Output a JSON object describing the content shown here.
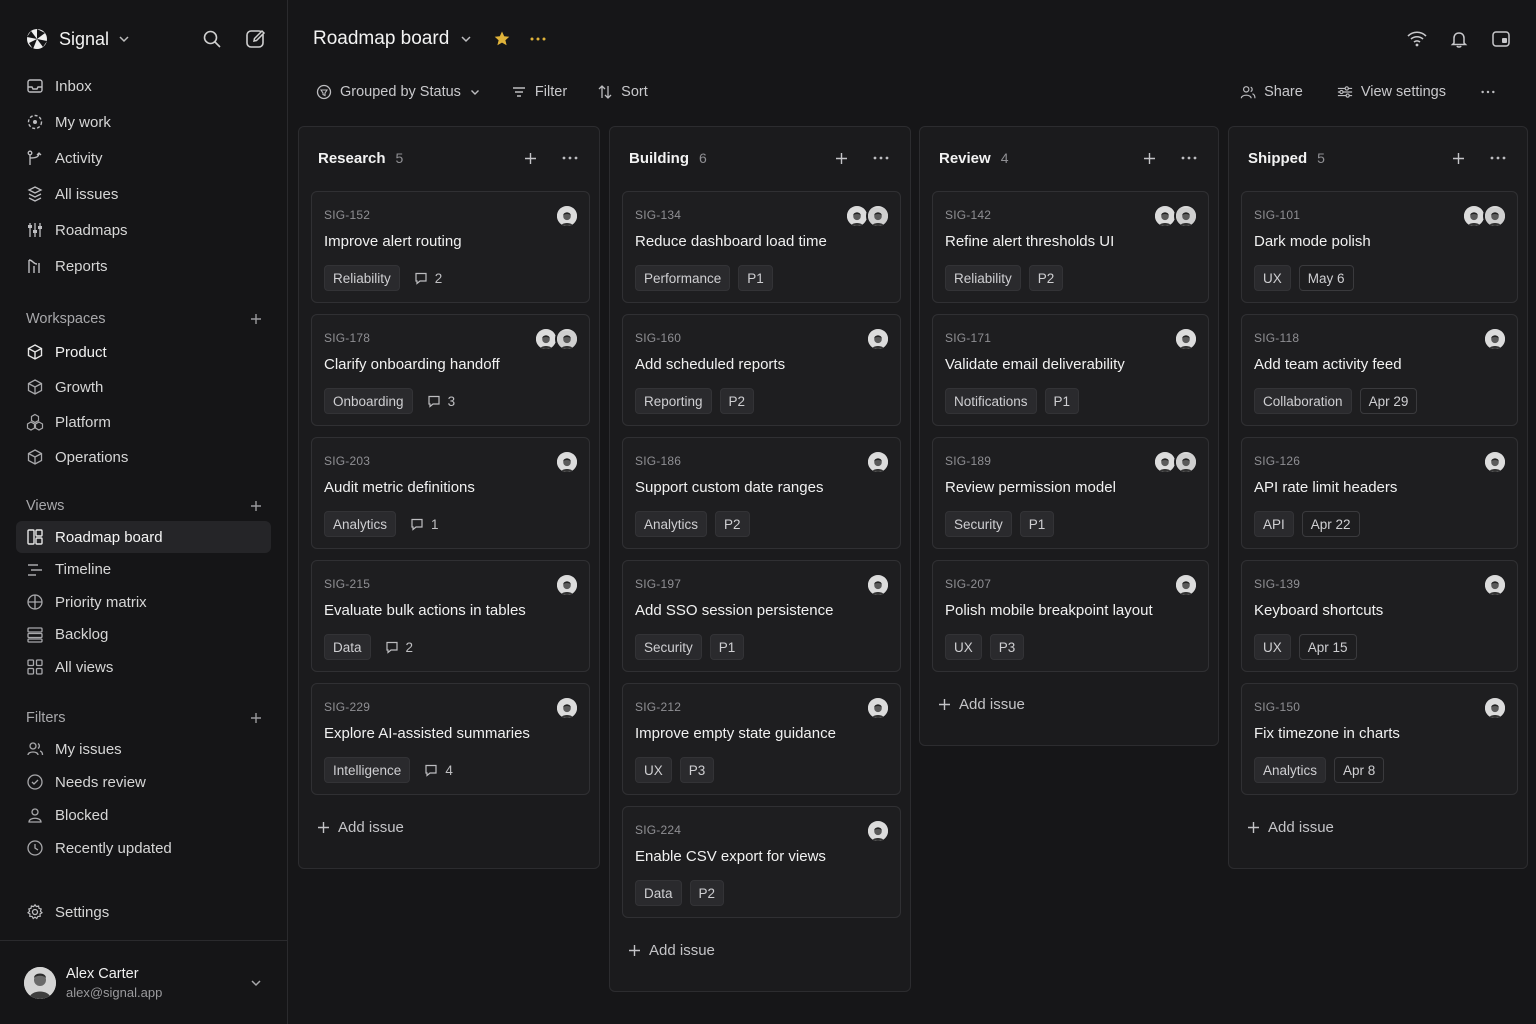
{
  "app": {
    "name": "Signal"
  },
  "sidebar": {
    "nav": [
      {
        "label": "Inbox",
        "icon": "inbox-icon"
      },
      {
        "label": "My work",
        "icon": "target-icon"
      },
      {
        "label": "Activity",
        "icon": "activity-icon"
      },
      {
        "label": "All issues",
        "icon": "issues-icon"
      },
      {
        "label": "Roadmaps",
        "icon": "roadmap-icon"
      },
      {
        "label": "Reports",
        "icon": "reports-icon"
      }
    ],
    "workspaces_title": "Workspaces",
    "workspaces": [
      {
        "label": "Product"
      },
      {
        "label": "Growth"
      },
      {
        "label": "Platform"
      },
      {
        "label": "Operations"
      }
    ],
    "views_title": "Views",
    "views": [
      {
        "label": "Roadmap board",
        "icon": "board-icon"
      },
      {
        "label": "Timeline",
        "icon": "timeline-icon"
      },
      {
        "label": "Priority matrix",
        "icon": "matrix-icon"
      },
      {
        "label": "Backlog",
        "icon": "backlog-icon"
      },
      {
        "label": "All views",
        "icon": "grid-icon"
      }
    ],
    "filters_title": "Filters",
    "filters": [
      {
        "label": "My issues",
        "icon": "users-icon"
      },
      {
        "label": "Needs review",
        "icon": "review-icon"
      },
      {
        "label": "Blocked",
        "icon": "blocked-icon"
      },
      {
        "label": "Recently updated",
        "icon": "clock-icon"
      }
    ],
    "settings_label": "Settings",
    "user": {
      "name": "Alex Carter",
      "email": "alex@signal.app"
    }
  },
  "header": {
    "title": "Roadmap board",
    "star_color": "#e0b33a"
  },
  "toolbar": {
    "group_label": "Grouped by Status",
    "filter_label": "Filter",
    "sort_label": "Sort",
    "share_label": "Share",
    "view_settings_label": "View settings"
  },
  "add_issue_label": "Add issue",
  "columns": [
    {
      "name": "Research",
      "count": "5",
      "cards": [
        {
          "id": "SIG-152",
          "title": "Improve alert routing",
          "tags": [
            "Reliability"
          ],
          "comments": "2",
          "avatars": 1
        },
        {
          "id": "SIG-178",
          "title": "Clarify onboarding handoff",
          "tags": [
            "Onboarding"
          ],
          "comments": "3",
          "avatars": 2
        },
        {
          "id": "SIG-203",
          "title": "Audit metric definitions",
          "tags": [
            "Analytics"
          ],
          "comments": "1",
          "avatars": 1
        },
        {
          "id": "SIG-215",
          "title": "Evaluate bulk actions in tables",
          "tags": [
            "Data"
          ],
          "comments": "2",
          "avatars": 1
        },
        {
          "id": "SIG-229",
          "title": "Explore AI-assisted summaries",
          "tags": [
            "Intelligence"
          ],
          "comments": "4",
          "avatars": 1
        }
      ]
    },
    {
      "name": "Building",
      "count": "6",
      "cards": [
        {
          "id": "SIG-134",
          "title": "Reduce dashboard load time",
          "tags": [
            "Performance",
            "P1"
          ],
          "avatars": 2
        },
        {
          "id": "SIG-160",
          "title": "Add scheduled reports",
          "tags": [
            "Reporting",
            "P2"
          ],
          "avatars": 1
        },
        {
          "id": "SIG-186",
          "title": "Support custom date ranges",
          "tags": [
            "Analytics",
            "P2"
          ],
          "avatars": 1
        },
        {
          "id": "SIG-197",
          "title": "Add SSO session persistence",
          "tags": [
            "Security",
            "P1"
          ],
          "avatars": 1
        },
        {
          "id": "SIG-212",
          "title": "Improve empty state guidance",
          "tags": [
            "UX",
            "P3"
          ],
          "avatars": 1
        },
        {
          "id": "SIG-224",
          "title": "Enable CSV export for views",
          "tags": [
            "Data",
            "P2"
          ],
          "avatars": 1
        }
      ]
    },
    {
      "name": "Review",
      "count": "4",
      "cards": [
        {
          "id": "SIG-142",
          "title": "Refine alert thresholds UI",
          "tags": [
            "Reliability",
            "P2"
          ],
          "avatars": 2
        },
        {
          "id": "SIG-171",
          "title": "Validate email deliverability",
          "tags": [
            "Notifications",
            "P1"
          ],
          "avatars": 1
        },
        {
          "id": "SIG-189",
          "title": "Review permission model",
          "tags": [
            "Security",
            "P1"
          ],
          "avatars": 2
        },
        {
          "id": "SIG-207",
          "title": "Polish mobile breakpoint layout",
          "tags": [
            "UX",
            "P3"
          ],
          "avatars": 1
        }
      ]
    },
    {
      "name": "Shipped",
      "count": "5",
      "cards": [
        {
          "id": "SIG-101",
          "title": "Dark mode polish",
          "tags": [
            "UX"
          ],
          "date": "May 6",
          "avatars": 2
        },
        {
          "id": "SIG-118",
          "title": "Add team activity feed",
          "tags": [
            "Collaboration"
          ],
          "date": "Apr 29",
          "avatars": 1
        },
        {
          "id": "SIG-126",
          "title": "API rate limit headers",
          "tags": [
            "API"
          ],
          "date": "Apr 22",
          "avatars": 1
        },
        {
          "id": "SIG-139",
          "title": "Keyboard shortcuts",
          "tags": [
            "UX"
          ],
          "date": "Apr 15",
          "avatars": 1
        },
        {
          "id": "SIG-150",
          "title": "Fix timezone in charts",
          "tags": [
            "Analytics"
          ],
          "date": "Apr 8",
          "avatars": 1
        }
      ]
    }
  ]
}
